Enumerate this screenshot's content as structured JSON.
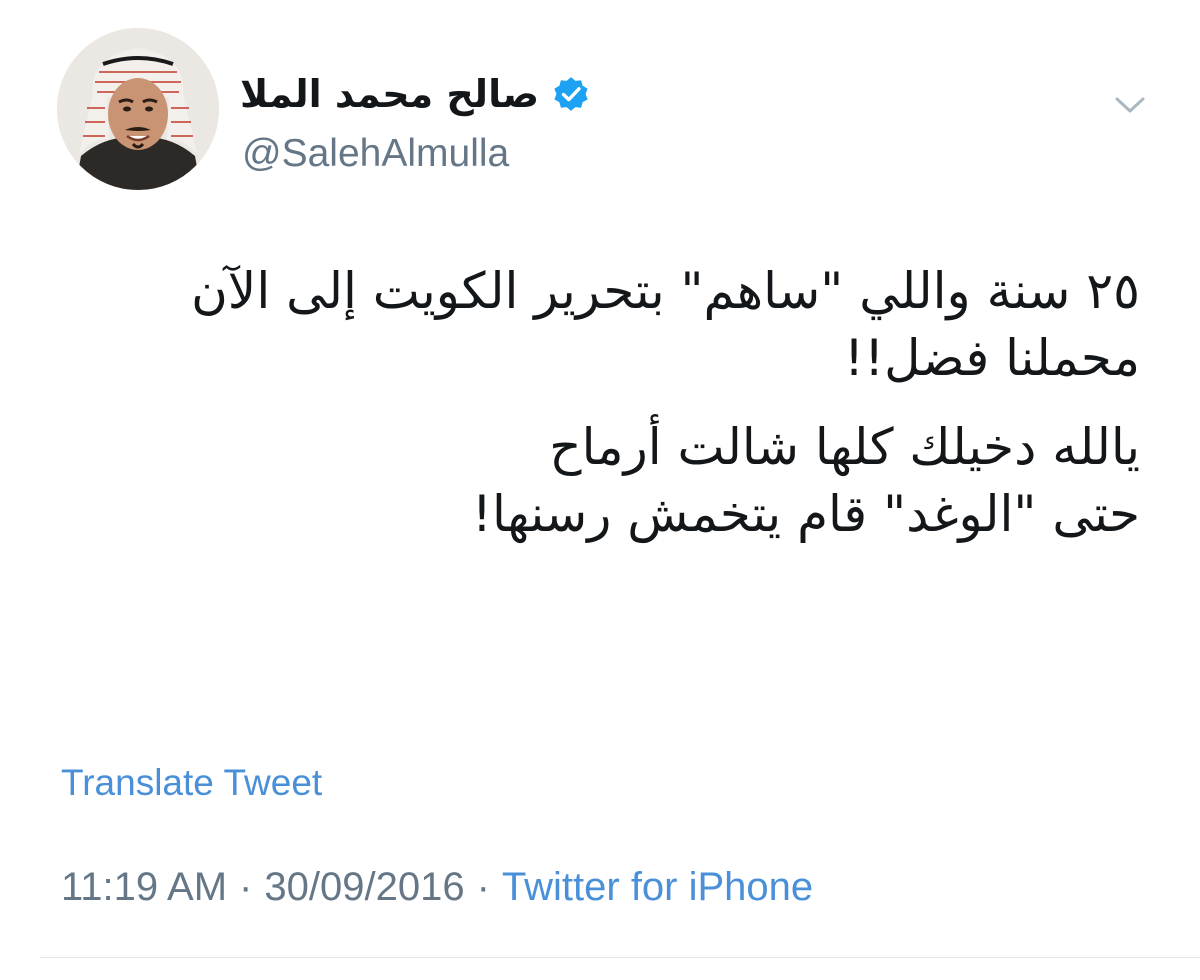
{
  "user": {
    "display_name": "صالح محمد الملا",
    "handle": "@SalehAlmulla",
    "verified": true
  },
  "tweet": {
    "paragraphs": [
      [
        "٢٥ سنة واللي \"ساهم\" بتحرير الكويت إلى الآن",
        "محملنا فضل!!"
      ],
      [
        "يالله دخيلك كلها شالت أرماح",
        "حتى \"الوغد\" قام يتخمش رسنها!"
      ]
    ],
    "translate_label": "Translate Tweet",
    "time": "11:19 AM",
    "date": "30/09/2016",
    "separator": "·",
    "source": "Twitter for iPhone"
  },
  "icons": {
    "menu": "chevron-down-icon",
    "verified": "verified-badge-icon"
  },
  "colors": {
    "link": "#4a90d9",
    "secondary_text": "#657786",
    "primary_text": "#14171a",
    "verified": "#1da1f2"
  }
}
